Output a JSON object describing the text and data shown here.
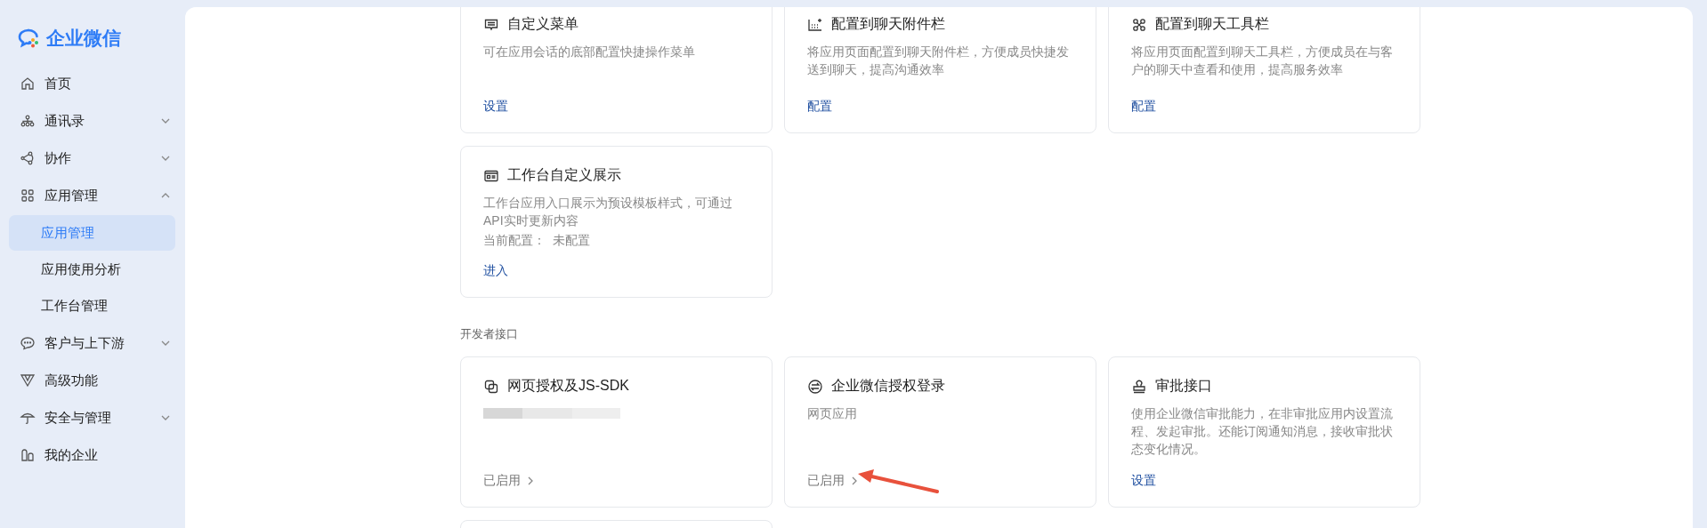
{
  "sidebar": {
    "logo_text": "企业微信",
    "items": [
      {
        "label": "首页",
        "kind": "page",
        "selected": false
      },
      {
        "label": "通讯录",
        "kind": "group",
        "expanded": false
      },
      {
        "label": "协作",
        "kind": "group",
        "expanded": false
      },
      {
        "label": "应用管理",
        "kind": "group",
        "expanded": true,
        "children": [
          {
            "label": "应用管理",
            "selected": true
          },
          {
            "label": "应用使用分析",
            "selected": false
          },
          {
            "label": "工作台管理",
            "selected": false
          }
        ]
      },
      {
        "label": "客户与上下游",
        "kind": "group",
        "expanded": false
      },
      {
        "label": "高级功能",
        "kind": "page",
        "selected": false
      },
      {
        "label": "安全与管理",
        "kind": "group",
        "expanded": false
      },
      {
        "label": "我的企业",
        "kind": "page",
        "selected": false
      }
    ]
  },
  "sections": [
    {
      "cards": [
        {
          "title": "自定义菜单",
          "description": "可在应用会话的底部配置快捷操作菜单",
          "action": {
            "label": "设置",
            "kind": "link"
          }
        },
        {
          "title": "配置到聊天附件栏",
          "description": "将应用页面配置到聊天附件栏，方便成员快捷发送到聊天，提高沟通效率",
          "action": {
            "label": "配置",
            "kind": "link"
          }
        },
        {
          "title": "配置到聊天工具栏",
          "description": "将应用页面配置到聊天工具栏，方便成员在与客户的聊天中查看和使用，提高服务效率",
          "action": {
            "label": "配置",
            "kind": "link"
          }
        },
        {
          "title": "工作台自定义展示",
          "description": "工作台应用入口展示为预设模板样式，可通过API实时更新内容",
          "config_label": "当前配置：",
          "config_value": "未配置",
          "action": {
            "label": "进入",
            "kind": "link"
          }
        }
      ]
    },
    {
      "heading": "开发者接口",
      "cards": [
        {
          "title": "网页授权及JS-SDK",
          "redacted": true,
          "action": {
            "label": "已启用",
            "kind": "status"
          }
        },
        {
          "title": "企业微信授权登录",
          "description": "网页应用",
          "action": {
            "label": "已启用",
            "kind": "status"
          }
        },
        {
          "title": "审批接口",
          "description": "使用企业微信审批能力，在非审批应用内设置流程、发起审批。还能订阅通知消息，接收审批状态变化情况。",
          "action": {
            "label": "设置",
            "kind": "link"
          }
        }
      ],
      "more_below": true
    }
  ]
}
